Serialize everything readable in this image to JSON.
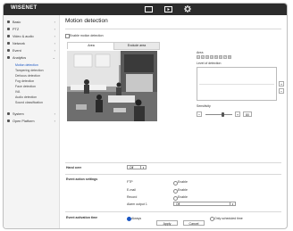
{
  "header": {
    "logo": "WISENET"
  },
  "sidebar": {
    "items": [
      {
        "label": "Basic",
        "icon": "camera-icon"
      },
      {
        "label": "PTZ",
        "icon": "ptz-icon"
      },
      {
        "label": "Video & audio",
        "icon": "video-icon"
      },
      {
        "label": "Network",
        "icon": "network-icon"
      },
      {
        "label": "Event",
        "icon": "event-icon"
      },
      {
        "label": "Analytics",
        "icon": "analytics-icon"
      }
    ],
    "subitems": [
      "Motion detection",
      "Tampering detection",
      "Defocus detection",
      "Fog detection",
      "Face detection",
      "IVA",
      "Audio detection",
      "Sound classification"
    ],
    "bottom_items": [
      {
        "label": "System",
        "icon": "system-icon"
      },
      {
        "label": "Open Platform",
        "icon": "open-platform-icon"
      }
    ]
  },
  "main": {
    "title": "Motion detection",
    "enable_label": "Enable motion detection",
    "tabs": [
      "Area",
      "Exclude area"
    ],
    "area": {
      "label": "Area",
      "buttons": [
        "1",
        "2",
        "3",
        "4",
        "5",
        "6",
        "7",
        "8"
      ]
    },
    "level": {
      "label": "Level of detection"
    },
    "sensitivity": {
      "label": "Sensitivity",
      "value": "80"
    },
    "hand_over": {
      "label": "Hand over",
      "value": "Off"
    },
    "event_action": {
      "label": "Event action settings",
      "rows": [
        {
          "name": "FTP",
          "option": "Enable"
        },
        {
          "name": "E-mail",
          "option": "Enable"
        },
        {
          "name": "Record",
          "option": "Enable"
        }
      ],
      "alarm_label": "Alarm output 1",
      "alarm_value": "Off"
    },
    "activation": {
      "label": "Event activation time",
      "always": "Always",
      "scheduled": "Only scheduled time"
    },
    "apply_label": "Apply",
    "cancel_label": "Cancel"
  }
}
